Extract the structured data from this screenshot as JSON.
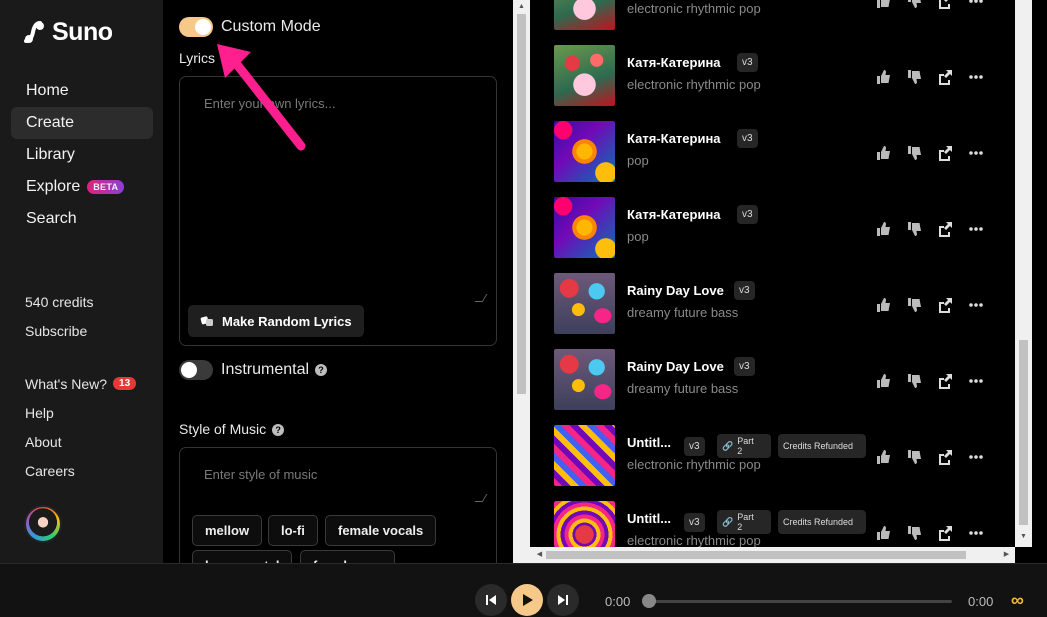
{
  "app": {
    "name": "Suno"
  },
  "nav": [
    {
      "label": "Home",
      "active": false
    },
    {
      "label": "Create",
      "active": true
    },
    {
      "label": "Library",
      "active": false
    },
    {
      "label": "Explore",
      "active": false,
      "badge": "BETA"
    },
    {
      "label": "Search",
      "active": false
    }
  ],
  "account": {
    "credits": "540 credits",
    "subscribe": "Subscribe"
  },
  "links": {
    "whats_new": "What's New?",
    "whats_new_count": "13",
    "help": "Help",
    "about": "About",
    "careers": "Careers"
  },
  "create": {
    "custom_mode_label": "Custom Mode",
    "custom_mode_on": true,
    "lyrics_label": "Lyrics",
    "lyrics_placeholder": "Enter your own lyrics...",
    "random_lyrics_button": "Make Random Lyrics",
    "instrumental_label": "Instrumental",
    "instrumental_on": false,
    "style_label": "Style of Music",
    "style_placeholder": "Enter style of music",
    "style_chips": [
      "mellow",
      "lo-fi",
      "female vocals",
      "heavy metal",
      "female pop"
    ]
  },
  "songs": [
    {
      "title": "",
      "style": "electronic rhythmic pop",
      "version": "",
      "thumb": "roses"
    },
    {
      "title": "Катя-Катерина",
      "style": "electronic rhythmic pop",
      "version": "v3",
      "thumb": "roses"
    },
    {
      "title": "Катя-Катерина",
      "style": "pop",
      "version": "v3",
      "thumb": "suns"
    },
    {
      "title": "Катя-Катерина",
      "style": "pop",
      "version": "v3",
      "thumb": "suns"
    },
    {
      "title": "Rainy Day Love",
      "style": "dreamy future bass",
      "version": "v3",
      "thumb": "umbrellas"
    },
    {
      "title": "Rainy Day Love",
      "style": "dreamy future bass",
      "version": "v3",
      "thumb": "umbrellas"
    },
    {
      "title": "Untitl...",
      "style": "electronic rhythmic pop",
      "version": "v3",
      "part": "Part 2",
      "status": "Credits Refunded",
      "thumb": "swirl"
    },
    {
      "title": "Untitl...",
      "style": "electronic rhythmic pop",
      "version": "v3",
      "part": "Part 2",
      "status": "Credits Refunded",
      "thumb": "heart"
    }
  ],
  "player": {
    "current_time": "0:00",
    "total_time": "0:00",
    "loop_symbol": "∞"
  },
  "colors": {
    "accent": "#f6c98a",
    "annotation_arrow": "#ff1f8e",
    "beta_badge": "#c0237e",
    "notification": "#e53935"
  }
}
